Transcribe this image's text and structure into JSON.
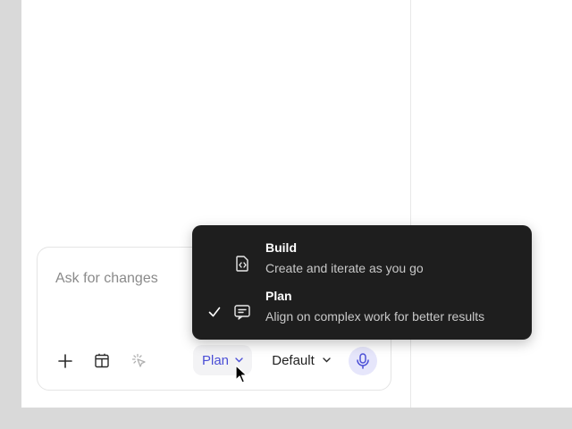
{
  "composer": {
    "placeholder": "Ask for changes",
    "value": "",
    "attach_icon": "plus-icon",
    "template_icon": "layout-icon",
    "select_element_icon": "cursor-click-icon",
    "mode_label": "Plan",
    "model_label": "Default",
    "voice_icon": "microphone-icon"
  },
  "mode_menu": {
    "items": [
      {
        "title": "Build",
        "description": "Create and iterate as you go",
        "icon": "code-file-icon",
        "selected": false
      },
      {
        "title": "Plan",
        "description": "Align on complex work for better results",
        "icon": "chat-plan-icon",
        "selected": true
      }
    ]
  },
  "colors": {
    "accent": "#4b4fd6",
    "accent_bg": "#e6e6fb",
    "menu_bg": "#1e1e1e",
    "menu_text": "#ffffff",
    "menu_subtext": "#c8c8c8",
    "placeholder": "#8a8a8a"
  }
}
